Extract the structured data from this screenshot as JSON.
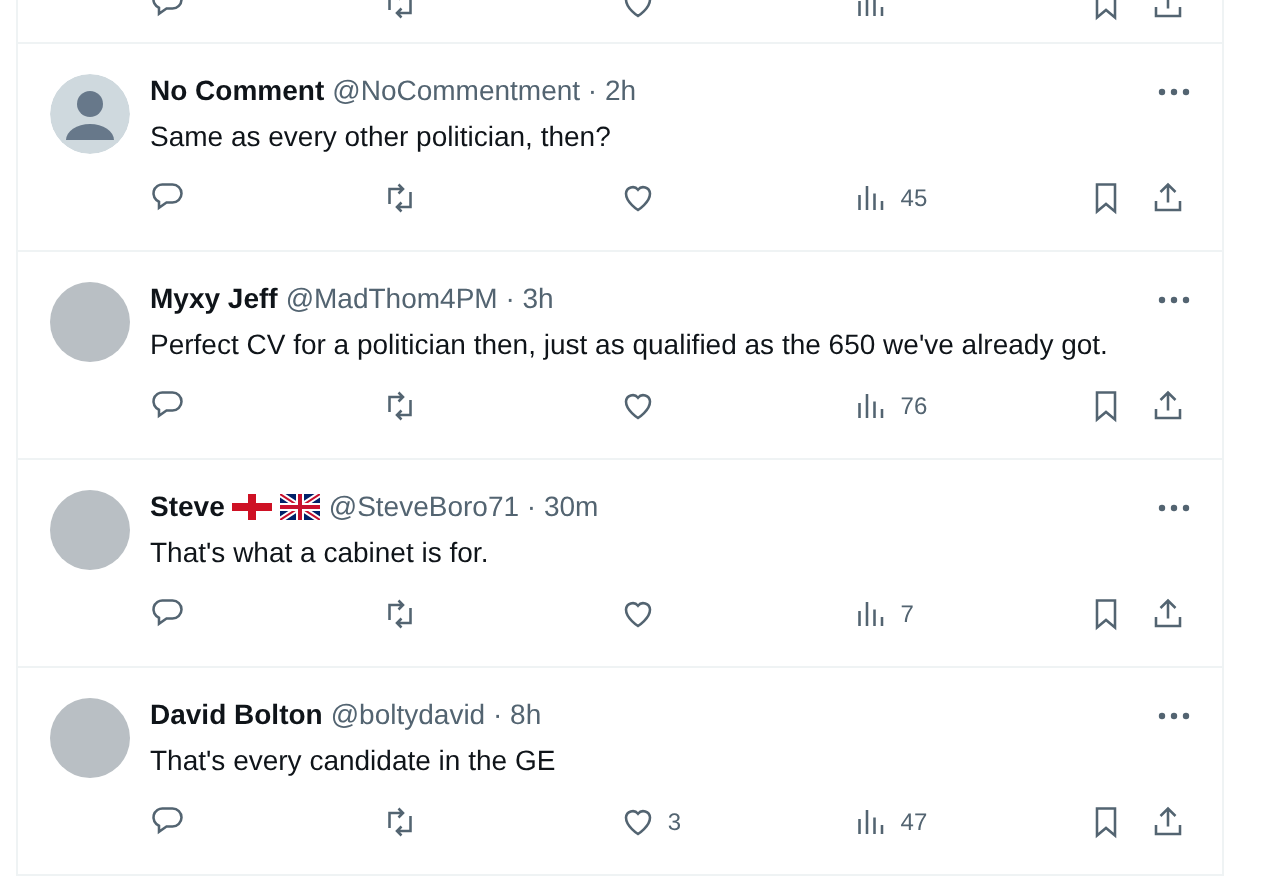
{
  "posts": [
    {
      "avatar": {
        "kind": "silhouette"
      },
      "name": "No Comment",
      "byline": "@NoCommentment · 2h",
      "text": "Same as every other politician, then?",
      "actions": {
        "views": "45"
      }
    },
    {
      "avatar": {
        "kind": "photo"
      },
      "name": "Myxy Jeff",
      "byline": "@MadThom4PM · 3h",
      "text": "Perfect CV for a politician then, just as qualified as the 650 we've already got.",
      "actions": {
        "views": "76"
      }
    },
    {
      "avatar": {
        "kind": "photo"
      },
      "name": "Steve",
      "flags": [
        {
          "kind": "england"
        },
        {
          "kind": "union"
        }
      ],
      "byline": "@SteveBoro71 · 30m",
      "text": "That's what a cabinet is for.",
      "actions": {
        "views": "7"
      }
    },
    {
      "avatar": {
        "kind": "photo"
      },
      "name": "David Bolton",
      "byline": "@boltydavid · 8h",
      "text": "That's every candidate in the GE",
      "actions": {
        "likes": "3",
        "views": "47"
      }
    }
  ]
}
